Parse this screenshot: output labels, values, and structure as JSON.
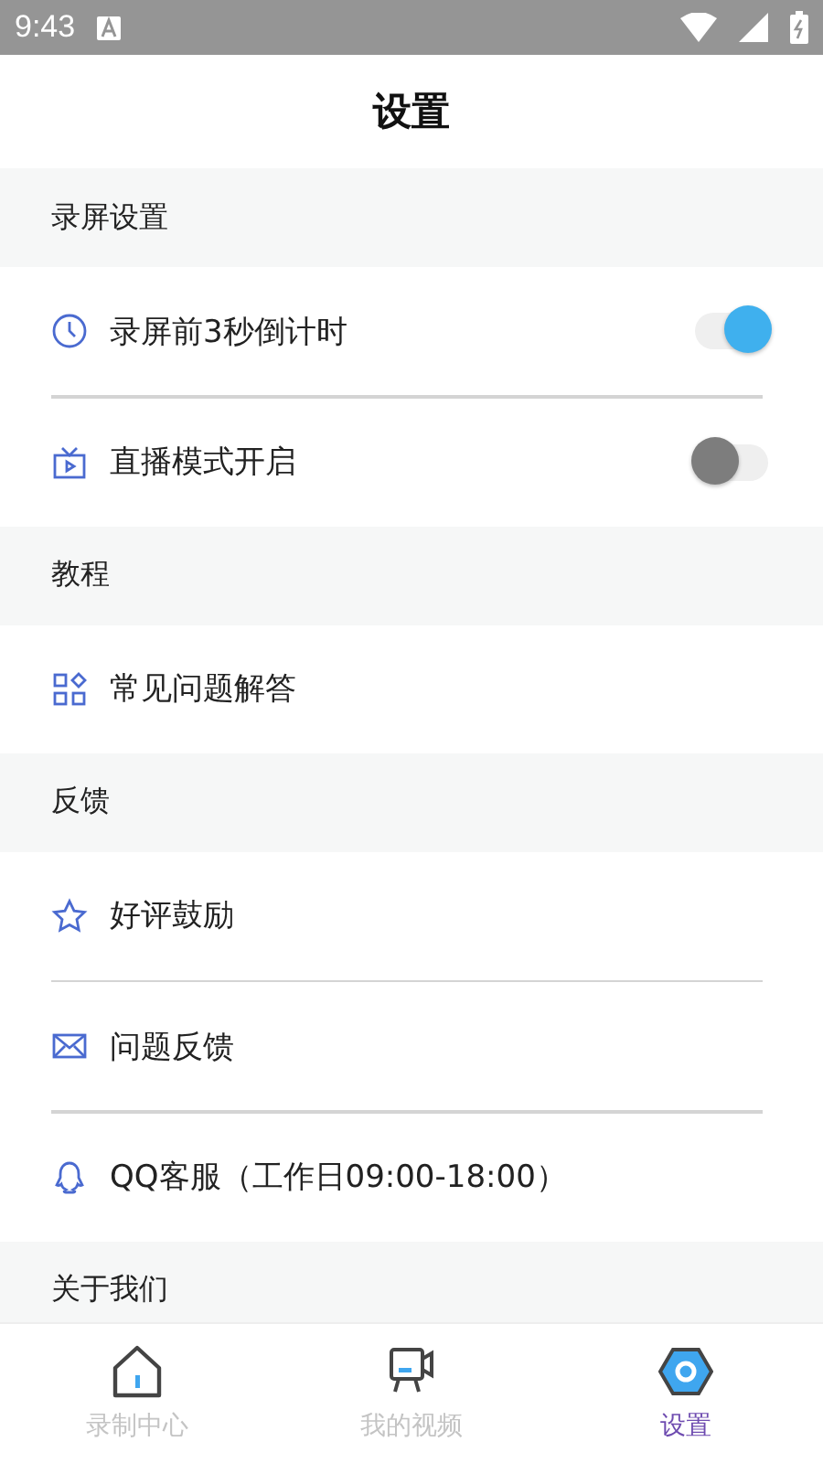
{
  "status_bar": {
    "time": "9:43"
  },
  "header": {
    "title": "设置"
  },
  "sections": [
    {
      "title": "录屏设置",
      "items": [
        {
          "kind": "toggle",
          "label": "录屏前3秒倒计时",
          "on": true
        },
        {
          "kind": "toggle",
          "label": "直播模式开启",
          "on": false
        }
      ]
    },
    {
      "title": "教程",
      "items": [
        {
          "kind": "link",
          "label": "常见问题解答"
        }
      ]
    },
    {
      "title": "反馈",
      "items": [
        {
          "kind": "link",
          "label": "好评鼓励"
        },
        {
          "kind": "link",
          "label": "问题反馈"
        },
        {
          "kind": "link",
          "label": "QQ客服（工作日09:00-18:00）"
        }
      ]
    },
    {
      "title": "关于我们"
    }
  ],
  "tabs": [
    {
      "label": "录制中心",
      "selected": false
    },
    {
      "label": "我的视频",
      "selected": false
    },
    {
      "label": "设置",
      "selected": true
    }
  ]
}
